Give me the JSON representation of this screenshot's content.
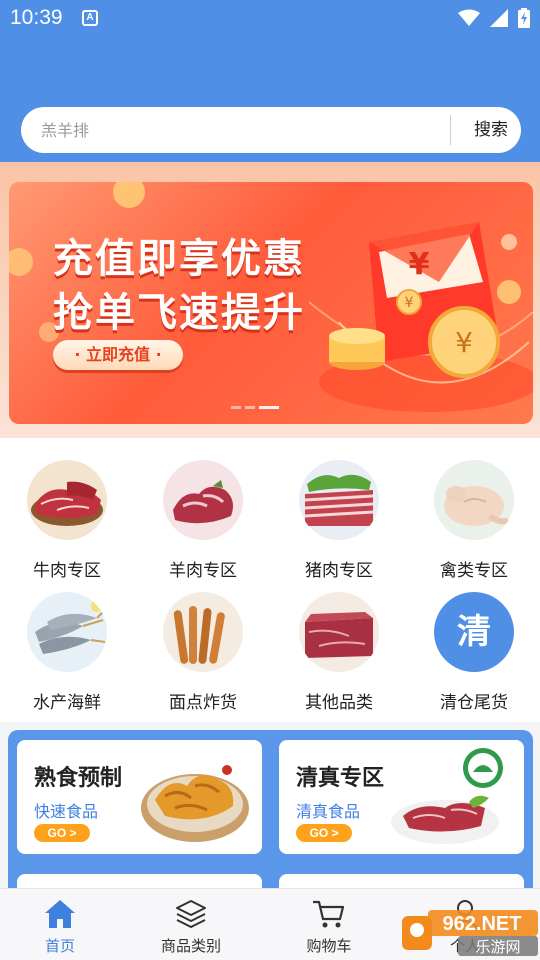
{
  "status_bar": {
    "time": "10:39",
    "notification_icon": "a-badge-icon",
    "icons": [
      "wifi-icon",
      "signal-icon",
      "battery-charging-icon"
    ]
  },
  "search": {
    "placeholder": "羔羊排",
    "button_label": "搜索"
  },
  "banner": {
    "line1": "充值即享优惠",
    "line2": "抢单飞速提升",
    "cta_label": "· 立即充值 ·",
    "slide_count": 3,
    "active_slide": 3
  },
  "categories": [
    {
      "label": "牛肉专区",
      "icon": "beef-image"
    },
    {
      "label": "羊肉专区",
      "icon": "lamb-image"
    },
    {
      "label": "猪肉专区",
      "icon": "pork-image"
    },
    {
      "label": "禽类专区",
      "icon": "poultry-image"
    },
    {
      "label": "水产海鲜",
      "icon": "seafood-image"
    },
    {
      "label": "面点炸货",
      "icon": "fried-food-image"
    },
    {
      "label": "其他品类",
      "icon": "other-meat-image"
    },
    {
      "label": "清仓尾货",
      "badge_text": "清"
    }
  ],
  "promos": [
    {
      "title": "熟食预制",
      "subtitle": "快速食品",
      "go_label": "GO >"
    },
    {
      "title": "清真专区",
      "subtitle": "清真食品",
      "go_label": "GO >"
    }
  ],
  "tabs": [
    {
      "label": "首页",
      "icon": "home-icon",
      "active": true
    },
    {
      "label": "商品类别",
      "icon": "layers-icon",
      "active": false
    },
    {
      "label": "购物车",
      "icon": "cart-icon",
      "active": false
    },
    {
      "label": "个人",
      "icon": "user-icon",
      "active": false
    }
  ],
  "watermark": {
    "line1": "962.NET",
    "line2": "乐游网"
  },
  "colors": {
    "brand_blue": "#4f8fe6",
    "accent_orange": "#ffa21b",
    "banner_red": "#ff5b3a",
    "link_blue": "#3f7fe0"
  }
}
